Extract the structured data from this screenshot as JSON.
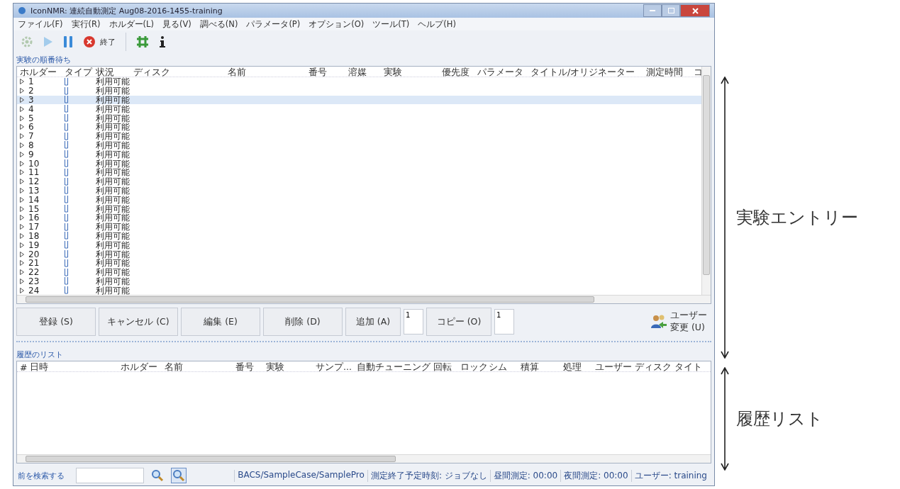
{
  "window": {
    "title": "IconNMR: 連続自動測定 Aug08-2016-1455-training"
  },
  "menu": [
    "ファイル(F)",
    "実行(R)",
    "ホルダー(L)",
    "見る(V)",
    "調べる(N)",
    "パラメータ(P)",
    "オプション(O)",
    "ツール(T)",
    "ヘルプ(H)"
  ],
  "toolbar": [
    {
      "kind": "gear",
      "disabled": true
    },
    {
      "kind": "play",
      "disabled": true
    },
    {
      "kind": "pause",
      "disabled": false
    },
    {
      "kind": "stop",
      "label": "終了",
      "disabled": false
    },
    {
      "kind": "separator"
    },
    {
      "kind": "grid",
      "disabled": false
    },
    {
      "kind": "info",
      "disabled": false
    }
  ],
  "queue": {
    "title": "実験の順番待ち",
    "columns": [
      "ホルダー",
      "タイプ",
      "状況",
      "ディスク",
      "名前",
      "番号",
      "溶媒",
      "実験",
      "優先度",
      "パラメータ",
      "タイトル/オリジネーター",
      "測定時間",
      "コ"
    ],
    "rows": [
      {
        "holder": "1",
        "status": "利用可能",
        "selected": false
      },
      {
        "holder": "2",
        "status": "利用可能",
        "selected": false
      },
      {
        "holder": "3",
        "status": "利用可能",
        "selected": true
      },
      {
        "holder": "4",
        "status": "利用可能",
        "selected": false
      },
      {
        "holder": "5",
        "status": "利用可能",
        "selected": false
      },
      {
        "holder": "6",
        "status": "利用可能",
        "selected": false
      },
      {
        "holder": "7",
        "status": "利用可能",
        "selected": false
      },
      {
        "holder": "8",
        "status": "利用可能",
        "selected": false
      },
      {
        "holder": "9",
        "status": "利用可能",
        "selected": false
      },
      {
        "holder": "10",
        "status": "利用可能",
        "selected": false
      },
      {
        "holder": "11",
        "status": "利用可能",
        "selected": false
      },
      {
        "holder": "12",
        "status": "利用可能",
        "selected": false
      },
      {
        "holder": "13",
        "status": "利用可能",
        "selected": false
      },
      {
        "holder": "14",
        "status": "利用可能",
        "selected": false
      },
      {
        "holder": "15",
        "status": "利用可能",
        "selected": false
      },
      {
        "holder": "16",
        "status": "利用可能",
        "selected": false
      },
      {
        "holder": "17",
        "status": "利用可能",
        "selected": false
      },
      {
        "holder": "18",
        "status": "利用可能",
        "selected": false
      },
      {
        "holder": "19",
        "status": "利用可能",
        "selected": false
      },
      {
        "holder": "20",
        "status": "利用可能",
        "selected": false
      },
      {
        "holder": "21",
        "status": "利用可能",
        "selected": false
      },
      {
        "holder": "22",
        "status": "利用可能",
        "selected": false
      },
      {
        "holder": "23",
        "status": "利用可能",
        "selected": false
      },
      {
        "holder": "24",
        "status": "利用可能",
        "selected": false
      }
    ]
  },
  "actions": [
    {
      "kind": "button",
      "label": "登録 (S)"
    },
    {
      "kind": "button",
      "label": "キャンセル (C)"
    },
    {
      "kind": "button",
      "label": "編集 (E)"
    },
    {
      "kind": "button",
      "label": "削除 (D)"
    },
    {
      "kind": "button",
      "label": "追加 (A)"
    },
    {
      "kind": "spin",
      "value": "1"
    },
    {
      "kind": "button",
      "label": "コピー (O)"
    },
    {
      "kind": "spin",
      "value": "1"
    }
  ],
  "user_button": {
    "label_top": "ユーザー",
    "label_bottom": "変更 (U)"
  },
  "history": {
    "title": "履歴のリスト",
    "columns": [
      "#",
      "日時",
      "ホルダー",
      "名前",
      "番号",
      "実験",
      "サンプ...",
      "自動チューニング",
      "回転",
      "ロック",
      "シム",
      "積算",
      "処理",
      "ユーザー",
      "ディスク",
      "タイト"
    ]
  },
  "search": {
    "label": "前を検索する"
  },
  "status_bar": [
    "BACS/SampleCase/SamplePro",
    "測定終了予定時刻: ジョブなし",
    "昼間測定: 00:00",
    "夜間測定: 00:00",
    "ユーザー: training"
  ],
  "annotations": [
    "実験エントリー",
    "履歴リスト"
  ]
}
